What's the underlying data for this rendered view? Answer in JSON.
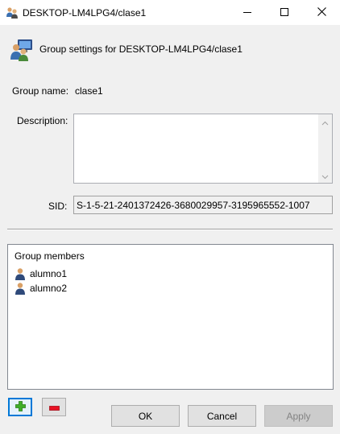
{
  "window": {
    "title": "DESKTOP-LM4LPG4/clase1",
    "controls": {
      "minimize": "minimize-icon",
      "maximize": "maximize-icon",
      "close": "close-icon"
    }
  },
  "header": {
    "text": "Group settings for DESKTOP-LM4LPG4/clase1",
    "icon": "group-computer-icon"
  },
  "form": {
    "group_name_label": "Group name:",
    "group_name_value": "clase1",
    "description_label": "Description:",
    "description_value": "",
    "sid_label": "SID:",
    "sid_value": "S-1-5-21-2401372426-3680029957-3195965552-1007"
  },
  "members": {
    "title": "Group members",
    "items": [
      {
        "name": "alumno1",
        "icon": "user-icon"
      },
      {
        "name": "alumno2",
        "icon": "user-icon"
      }
    ]
  },
  "buttons": {
    "add": "plus-icon",
    "remove": "minus-icon",
    "ok": "OK",
    "cancel": "Cancel",
    "apply": "Apply"
  },
  "colors": {
    "add_green": "#3fae29",
    "remove_red": "#e81123",
    "focus_blue": "#0078d7"
  }
}
